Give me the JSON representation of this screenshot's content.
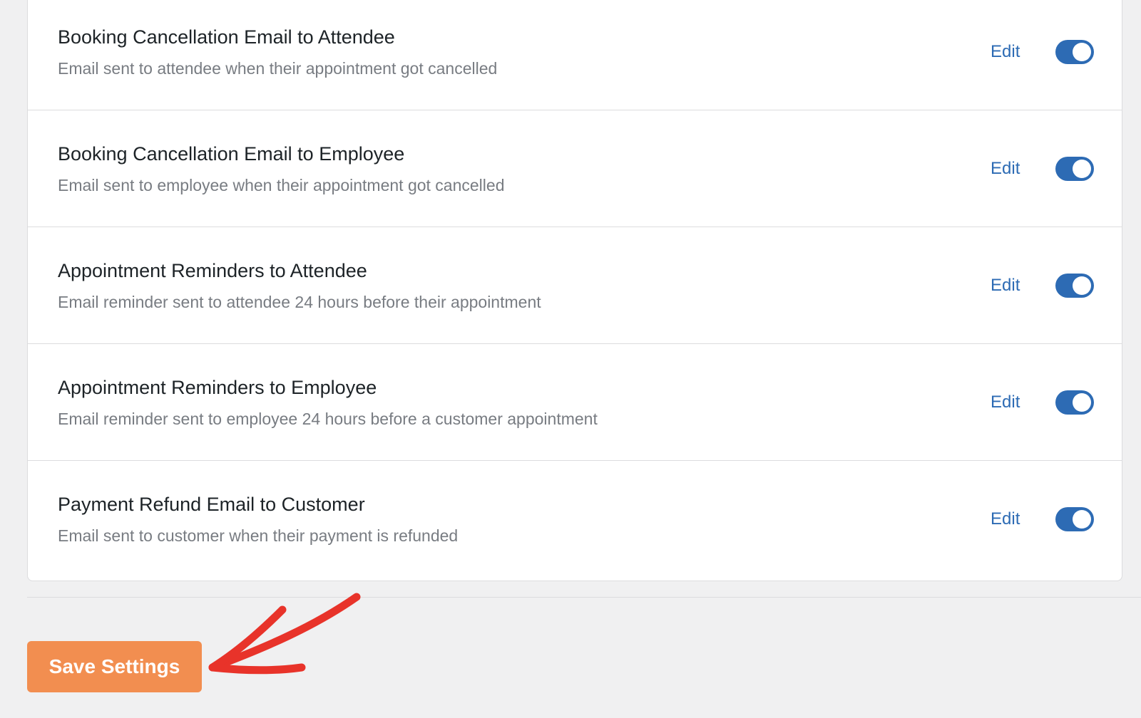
{
  "notifications": [
    {
      "title": "Booking Cancellation Email to Attendee",
      "description": "Email sent to attendee when their appointment got cancelled",
      "edit_label": "Edit",
      "enabled": true
    },
    {
      "title": "Booking Cancellation Email to Employee",
      "description": "Email sent to employee when their appointment got cancelled",
      "edit_label": "Edit",
      "enabled": true
    },
    {
      "title": "Appointment Reminders to Attendee",
      "description": "Email reminder sent to attendee 24 hours before their appointment",
      "edit_label": "Edit",
      "enabled": true
    },
    {
      "title": "Appointment Reminders to Employee",
      "description": "Email reminder sent to employee 24 hours before a customer appointment",
      "edit_label": "Edit",
      "enabled": true
    },
    {
      "title": "Payment Refund Email to Customer",
      "description": "Email sent to customer when their payment is refunded",
      "edit_label": "Edit",
      "enabled": true
    }
  ],
  "footer": {
    "save_label": "Save Settings"
  },
  "colors": {
    "accent_blue": "#2d6bb4",
    "save_button": "#f28e50",
    "annotation_arrow": "#e8332a"
  },
  "icons": {
    "toggle": "toggle-switch-on",
    "annotation": "red-arrow-annotation"
  }
}
